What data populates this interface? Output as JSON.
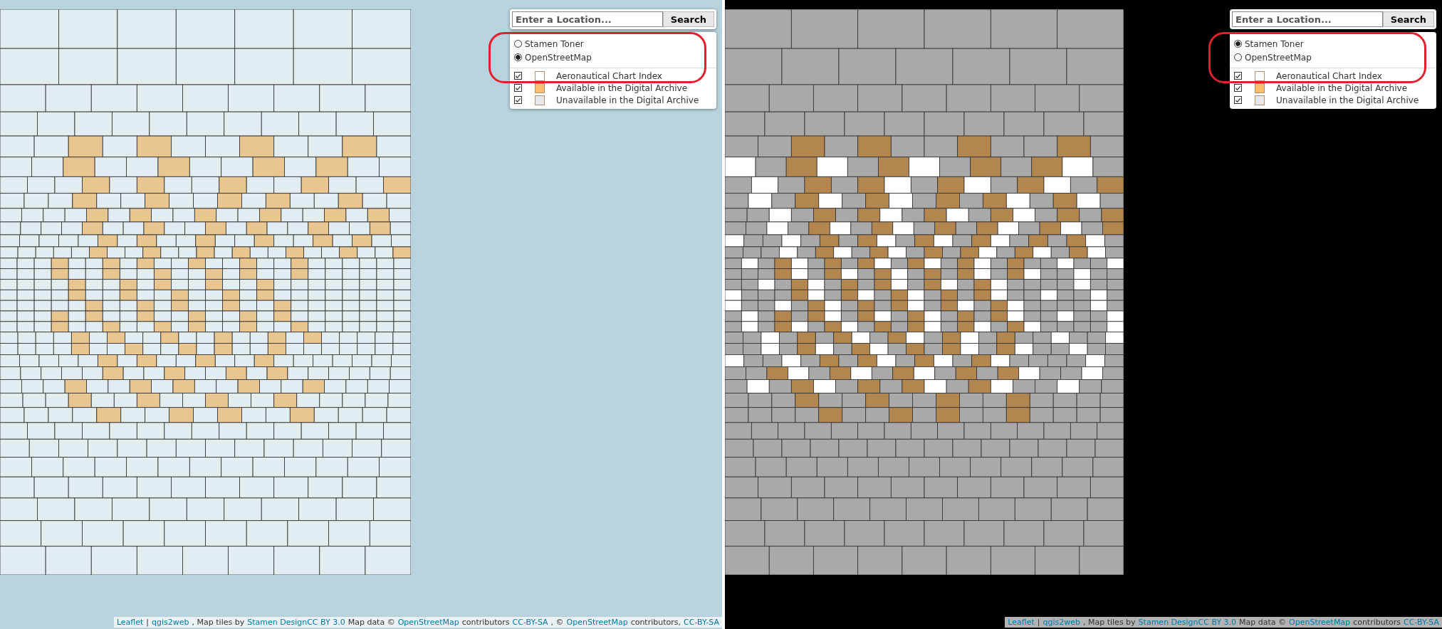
{
  "panels": [
    {
      "search": {
        "placeholder": "Enter a Location...",
        "button": "Search"
      },
      "layers": [
        {
          "label": "Stamen Toner",
          "selected": false
        },
        {
          "label": "OpenStreetMap",
          "selected": true
        }
      ],
      "highlighted": true,
      "overlays": [
        {
          "label": "Aeronautical Chart Index",
          "checked": true,
          "color": "#ffffff"
        },
        {
          "label": "Available in the Digital Archive",
          "checked": true,
          "color": "#fdbf6f"
        },
        {
          "label": "Unavailable in the Digital Archive",
          "checked": true,
          "color": "#e8e8e8"
        }
      ],
      "attribution": [
        {
          "kind": "link",
          "text": "Leaflet"
        },
        {
          "kind": "text",
          "text": "|"
        },
        {
          "kind": "link",
          "text": "qgis2web"
        },
        {
          "kind": "text",
          "text": ", Map tiles by"
        },
        {
          "kind": "link",
          "text": "Stamen DesignCC BY 3.0"
        },
        {
          "kind": "text",
          "text": "Map data ©"
        },
        {
          "kind": "link",
          "text": "OpenStreetMap"
        },
        {
          "kind": "text",
          "text": "contributors"
        },
        {
          "kind": "link",
          "text": "CC-BY-SA"
        },
        {
          "kind": "text",
          "text": ", ©"
        },
        {
          "kind": "link",
          "text": "OpenStreetMap"
        },
        {
          "kind": "text",
          "text": "contributors,"
        },
        {
          "kind": "link",
          "text": "CC-BY-SA"
        }
      ]
    },
    {
      "search": {
        "placeholder": "Enter a Location...",
        "button": "Search"
      },
      "layers": [
        {
          "label": "Stamen Toner",
          "selected": true
        },
        {
          "label": "OpenStreetMap",
          "selected": false
        }
      ],
      "highlighted": true,
      "overlays": [
        {
          "label": "Aeronautical Chart Index",
          "checked": true,
          "color": "#ffffff"
        },
        {
          "label": "Available in the Digital Archive",
          "checked": true,
          "color": "#fdbf6f"
        },
        {
          "label": "Unavailable in the Digital Archive",
          "checked": true,
          "color": "#e8e8e8"
        }
      ],
      "attribution": [
        {
          "kind": "link",
          "text": "Leaflet"
        },
        {
          "kind": "text",
          "text": "|"
        },
        {
          "kind": "link",
          "text": "qgis2web"
        },
        {
          "kind": "text",
          "text": ", Map tiles by"
        },
        {
          "kind": "link",
          "text": "Stamen DesignCC BY 3.0"
        },
        {
          "kind": "text",
          "text": "Map data ©"
        },
        {
          "kind": "link",
          "text": "OpenStreetMap"
        },
        {
          "kind": "text",
          "text": "contributors"
        },
        {
          "kind": "link",
          "text": "CC-BY-SA"
        }
      ]
    }
  ]
}
